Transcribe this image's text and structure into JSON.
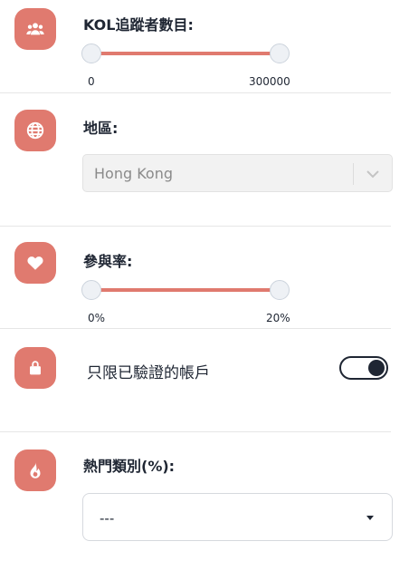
{
  "colors": {
    "accent": "#e07a6f",
    "text": "#1f2633",
    "divider": "#e6e6e6"
  },
  "followers": {
    "icon": "users-icon",
    "label": "KOL追蹤者數目:",
    "min_label": "0",
    "max_label": "300000",
    "range": [
      0,
      300000
    ]
  },
  "region": {
    "icon": "globe-icon",
    "label": "地區:",
    "selected": "Hong Kong",
    "disabled": true
  },
  "engagement": {
    "icon": "heart-icon",
    "label": "參與率:",
    "min_label": "0%",
    "max_label": "20%",
    "range": [
      0,
      20
    ]
  },
  "verified": {
    "icon": "lock-icon",
    "label": "只限已驗證的帳戶",
    "enabled": true
  },
  "category": {
    "icon": "fire-icon",
    "label": "熱門類別(%):",
    "selected": "---"
  }
}
